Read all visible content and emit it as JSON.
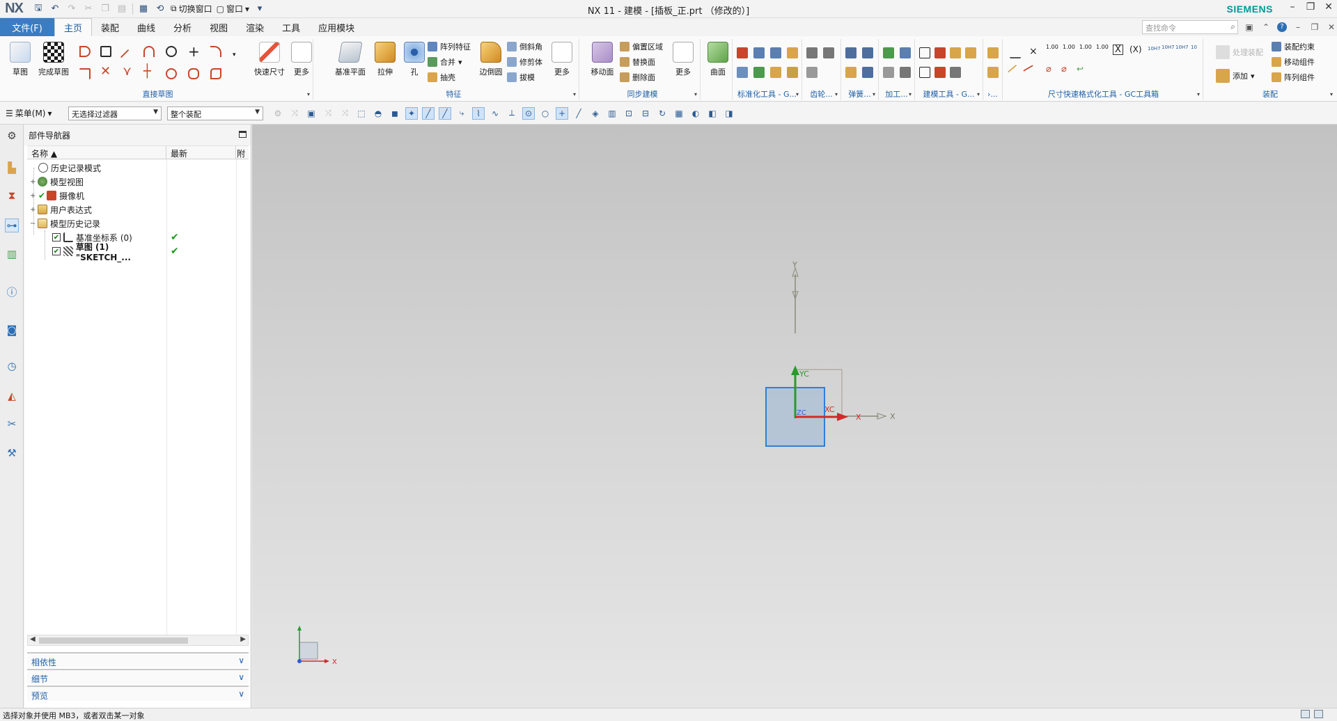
{
  "app": {
    "logo": "NX",
    "title": "NX 11 - 建模 - [插板_正.prt （修改的）]",
    "brand": "SIEMENS",
    "qat_switch_window": "切换窗口",
    "qat_window": "窗口"
  },
  "tabs": {
    "file": "文件(F)",
    "items": [
      "主页",
      "装配",
      "曲线",
      "分析",
      "视图",
      "渲染",
      "工具",
      "应用模块"
    ],
    "active": "主页",
    "search_placeholder": "查找命令"
  },
  "ribbon": {
    "sketch_group": {
      "label": "直接草图",
      "sketch": "草图",
      "finish": "完成草图"
    },
    "quick_dim": "快速尺寸",
    "more": "更多",
    "feature_group": {
      "label": "特征",
      "datum_plane": "基准平面",
      "extrude": "拉伸",
      "hole": "孔",
      "pattern_feature": "阵列特征",
      "unite": "合并",
      "shell": "抽壳",
      "edge_blend": "边倒圆",
      "chamfer": "倒斜角",
      "trim_body": "修剪体",
      "draft": "拔模",
      "more": "更多"
    },
    "sync_group": {
      "label": "同步建模",
      "move_face": "移动面",
      "offset_region": "偏置区域",
      "replace_face": "替换面",
      "delete_face": "删除面",
      "more": "更多"
    },
    "surface": "曲面",
    "std_tools": "标准化工具 - G...",
    "gear": "齿轮...",
    "spring": "弹簧...",
    "machining": "加工...",
    "modeling_tools": "建模工具 - G...",
    "more_dd": "›...",
    "dim_tools": "尺寸快速格式化工具 - GC工具箱",
    "dim_values": [
      "1.00",
      "1.00",
      "1.00",
      "1.00",
      "10H7",
      "10H7",
      "10H7",
      "10"
    ],
    "assembly_group": {
      "label": "装配",
      "hide_assembly": "处理装配",
      "assembly_constraints": "装配约束",
      "move_component": "移动组件",
      "add": "添加",
      "pattern_component": "阵列组件"
    }
  },
  "toolbar2": {
    "menu": "菜单(M)",
    "filter": "无选择过滤器",
    "scope": "整个装配"
  },
  "navigator": {
    "title": "部件导航器",
    "col_name": "名称",
    "col_latest": "最新",
    "col_extra": "附",
    "rows": [
      {
        "label": "历史记录模式",
        "latest": ""
      },
      {
        "label": "模型视图",
        "latest": ""
      },
      {
        "label": "摄像机",
        "latest": ""
      },
      {
        "label": "用户表达式",
        "latest": ""
      },
      {
        "label": "模型历史记录",
        "latest": ""
      },
      {
        "label": "基准坐标系 (0)",
        "latest": "✔"
      },
      {
        "label": "草图 (1) \"SKETCH_...",
        "latest": "✔"
      }
    ],
    "sections": [
      "相依性",
      "细节",
      "预览"
    ]
  },
  "viewport": {
    "axis_labels": {
      "y": "Y",
      "yc": "YC",
      "xc": "XC",
      "x": "X",
      "zc": "ZC",
      "x2": "X",
      "triad_x": "X"
    }
  },
  "status": {
    "message": "选择对象并使用 MB3，或者双击某一对象"
  }
}
